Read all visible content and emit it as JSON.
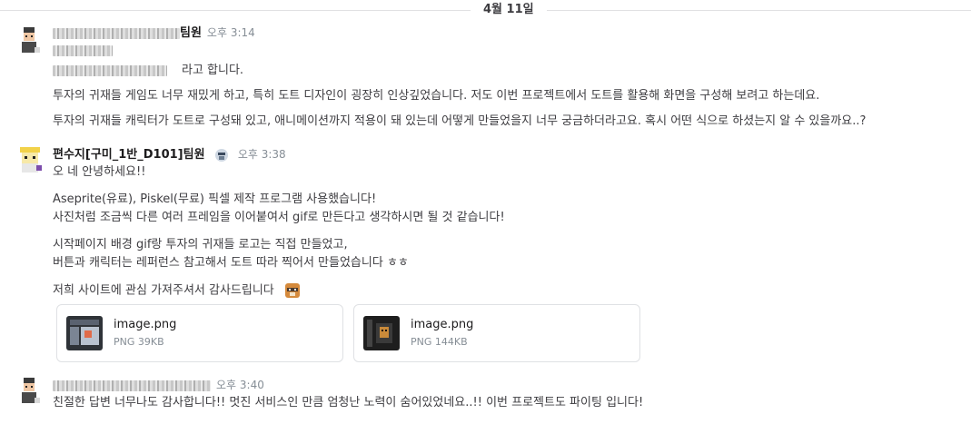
{
  "date_divider": "4월 11일",
  "messages": [
    {
      "author_suffix": "팀원",
      "time": "오후 3:14",
      "line3_tail": "라고 합니다.",
      "line4": "투자의 귀재들 게임도 너무 재밌게 하고, 특히 도트 디자인이 굉장히 인상깊었습니다. 저도 이번 프로젝트에서 도트를 활용해 화면을 구성해 보려고 하는데요.",
      "line5": "투자의 귀재들 캐릭터가 도트로 구성돼 있고, 애니메이션까지 적용이 돼 있는데 어떻게 만들었을지 너무 궁금하더라고요. 혹시 어떤 식으로 하셨는지 알 수 있을까요..?"
    },
    {
      "author": "편수지[구미_1반_D101]팀원",
      "time": "오후 3:38",
      "lines": [
        "오 네 안녕하세요!!",
        "Aseprite(유료), Piskel(무료) 픽셀 제작 프로그램 사용했습니다!",
        "사진처럼 조금씩 다른 여러 프레임을 이어붙여서 gif로 만든다고 생각하시면 될 것 같습니다!",
        "시작페이지 배경 gif랑 투자의 귀재들 로고는 직접 만들었고,",
        "버튼과 캐릭터는 레퍼런스 참고해서 도트 따라 찍어서 만들었습니다 ㅎㅎ",
        "저희 사이트에 관심 가져주셔서 감사드립니다"
      ],
      "files": [
        {
          "name": "image.png",
          "meta": "PNG 39KB"
        },
        {
          "name": "image.png",
          "meta": "PNG 144KB"
        }
      ]
    },
    {
      "time": "오후 3:40",
      "line": "친절한 답변 너무나도 감사합니다!! 멋진 서비스인 만큼 엄청난 노력이 숨어있었네요..!! 이번 프로젝트도 파이팅 입니다!"
    }
  ],
  "icons": [
    "avatar-pixel-person-icon",
    "avatar-pixel-character-icon",
    "profile-badge-icon",
    "raccoon-emoji-icon",
    "file-thumbnail-icon"
  ]
}
